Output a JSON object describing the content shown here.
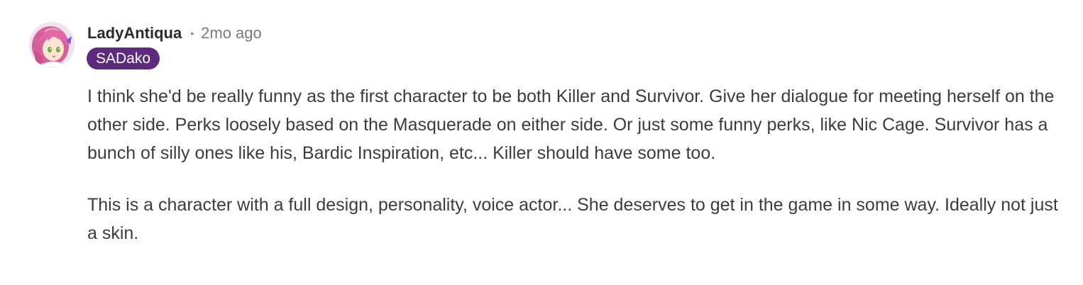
{
  "comment": {
    "author": "LadyAntiqua",
    "separator": "•",
    "timestamp": "2mo ago",
    "flair": "SADako",
    "flair_color": "#5e2a7e",
    "avatar_icon": "anime-character-avatar-icon",
    "paragraphs": [
      "I think she'd be really funny as the first character to be both Killer and Survivor. Give her dialogue for meeting herself on the other side. Perks loosely based on the Masquerade on either side. Or just some funny perks, like Nic Cage. Survivor has a bunch of silly ones like his, Bardic Inspiration, etc... Killer should have some too.",
      "This is a character with a full design, personality, voice actor... She deserves to get in the game in some way. Ideally not just a skin."
    ]
  }
}
